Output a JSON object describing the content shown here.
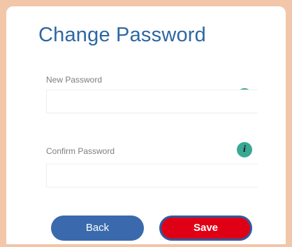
{
  "form": {
    "title": "Change Password",
    "new_password_label": "New Password",
    "new_password_value": "",
    "confirm_password_label": "Confirm Password",
    "confirm_password_value": "",
    "info_icon_glyph": "i",
    "back_label": "Back",
    "save_label": "Save"
  },
  "colors": {
    "title": "#2d67a3",
    "info_icon": "#3aa892",
    "back_button": "#3a6aad",
    "save_button": "#e00015",
    "frame": "#f2c6a8"
  }
}
